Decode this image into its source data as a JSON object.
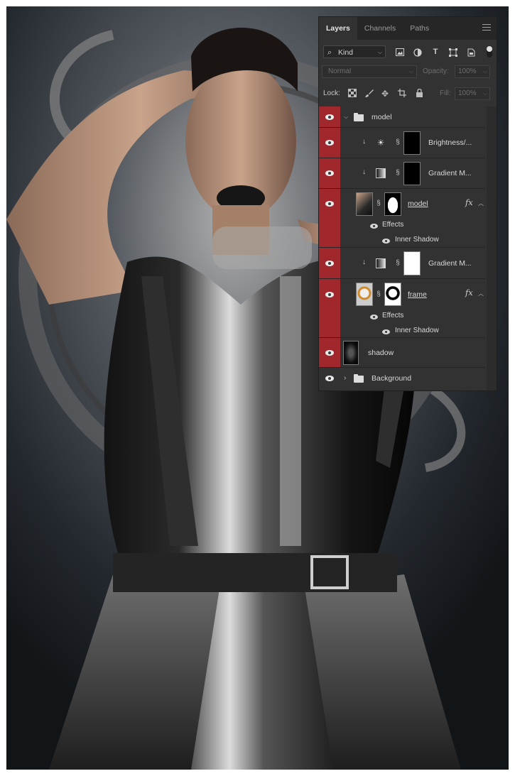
{
  "panel": {
    "tabs": [
      {
        "label": "Layers",
        "active": true
      },
      {
        "label": "Channels",
        "active": false
      },
      {
        "label": "Paths",
        "active": false
      }
    ],
    "filter": {
      "kind_label": "Kind",
      "icons": [
        "image-filter-icon",
        "adjustment-filter-icon",
        "type-filter-icon",
        "shape-filter-icon",
        "smart-object-filter-icon"
      ]
    },
    "blend": {
      "mode": "Normal",
      "opacity_label": "Opacity:",
      "opacity_value": "100%"
    },
    "lock": {
      "label": "Lock:",
      "fill_label": "Fill:",
      "fill_value": "100%"
    },
    "layers": [
      {
        "name": "model",
        "type": "group",
        "expanded": true
      },
      {
        "name": "Brightness/...",
        "type": "adjustment",
        "clipped": true
      },
      {
        "name": "Gradient M...",
        "type": "adjustment",
        "clipped": true
      },
      {
        "name": "model",
        "type": "pixel",
        "fx": "fx",
        "effects_label": "Effects",
        "effects": [
          "Inner Shadow"
        ]
      },
      {
        "name": "Gradient M...",
        "type": "adjustment",
        "clipped": true
      },
      {
        "name": "frame",
        "type": "pixel",
        "fx": "fx",
        "effects_label": "Effects",
        "effects": [
          "Inner Shadow"
        ]
      },
      {
        "name": "shadow",
        "type": "pixel"
      },
      {
        "name": "Background",
        "type": "group",
        "expanded": false
      }
    ]
  },
  "colors": {
    "panel_bg": "#323232",
    "tab_bg": "#262626",
    "visibility_highlight": "#a0282c"
  }
}
